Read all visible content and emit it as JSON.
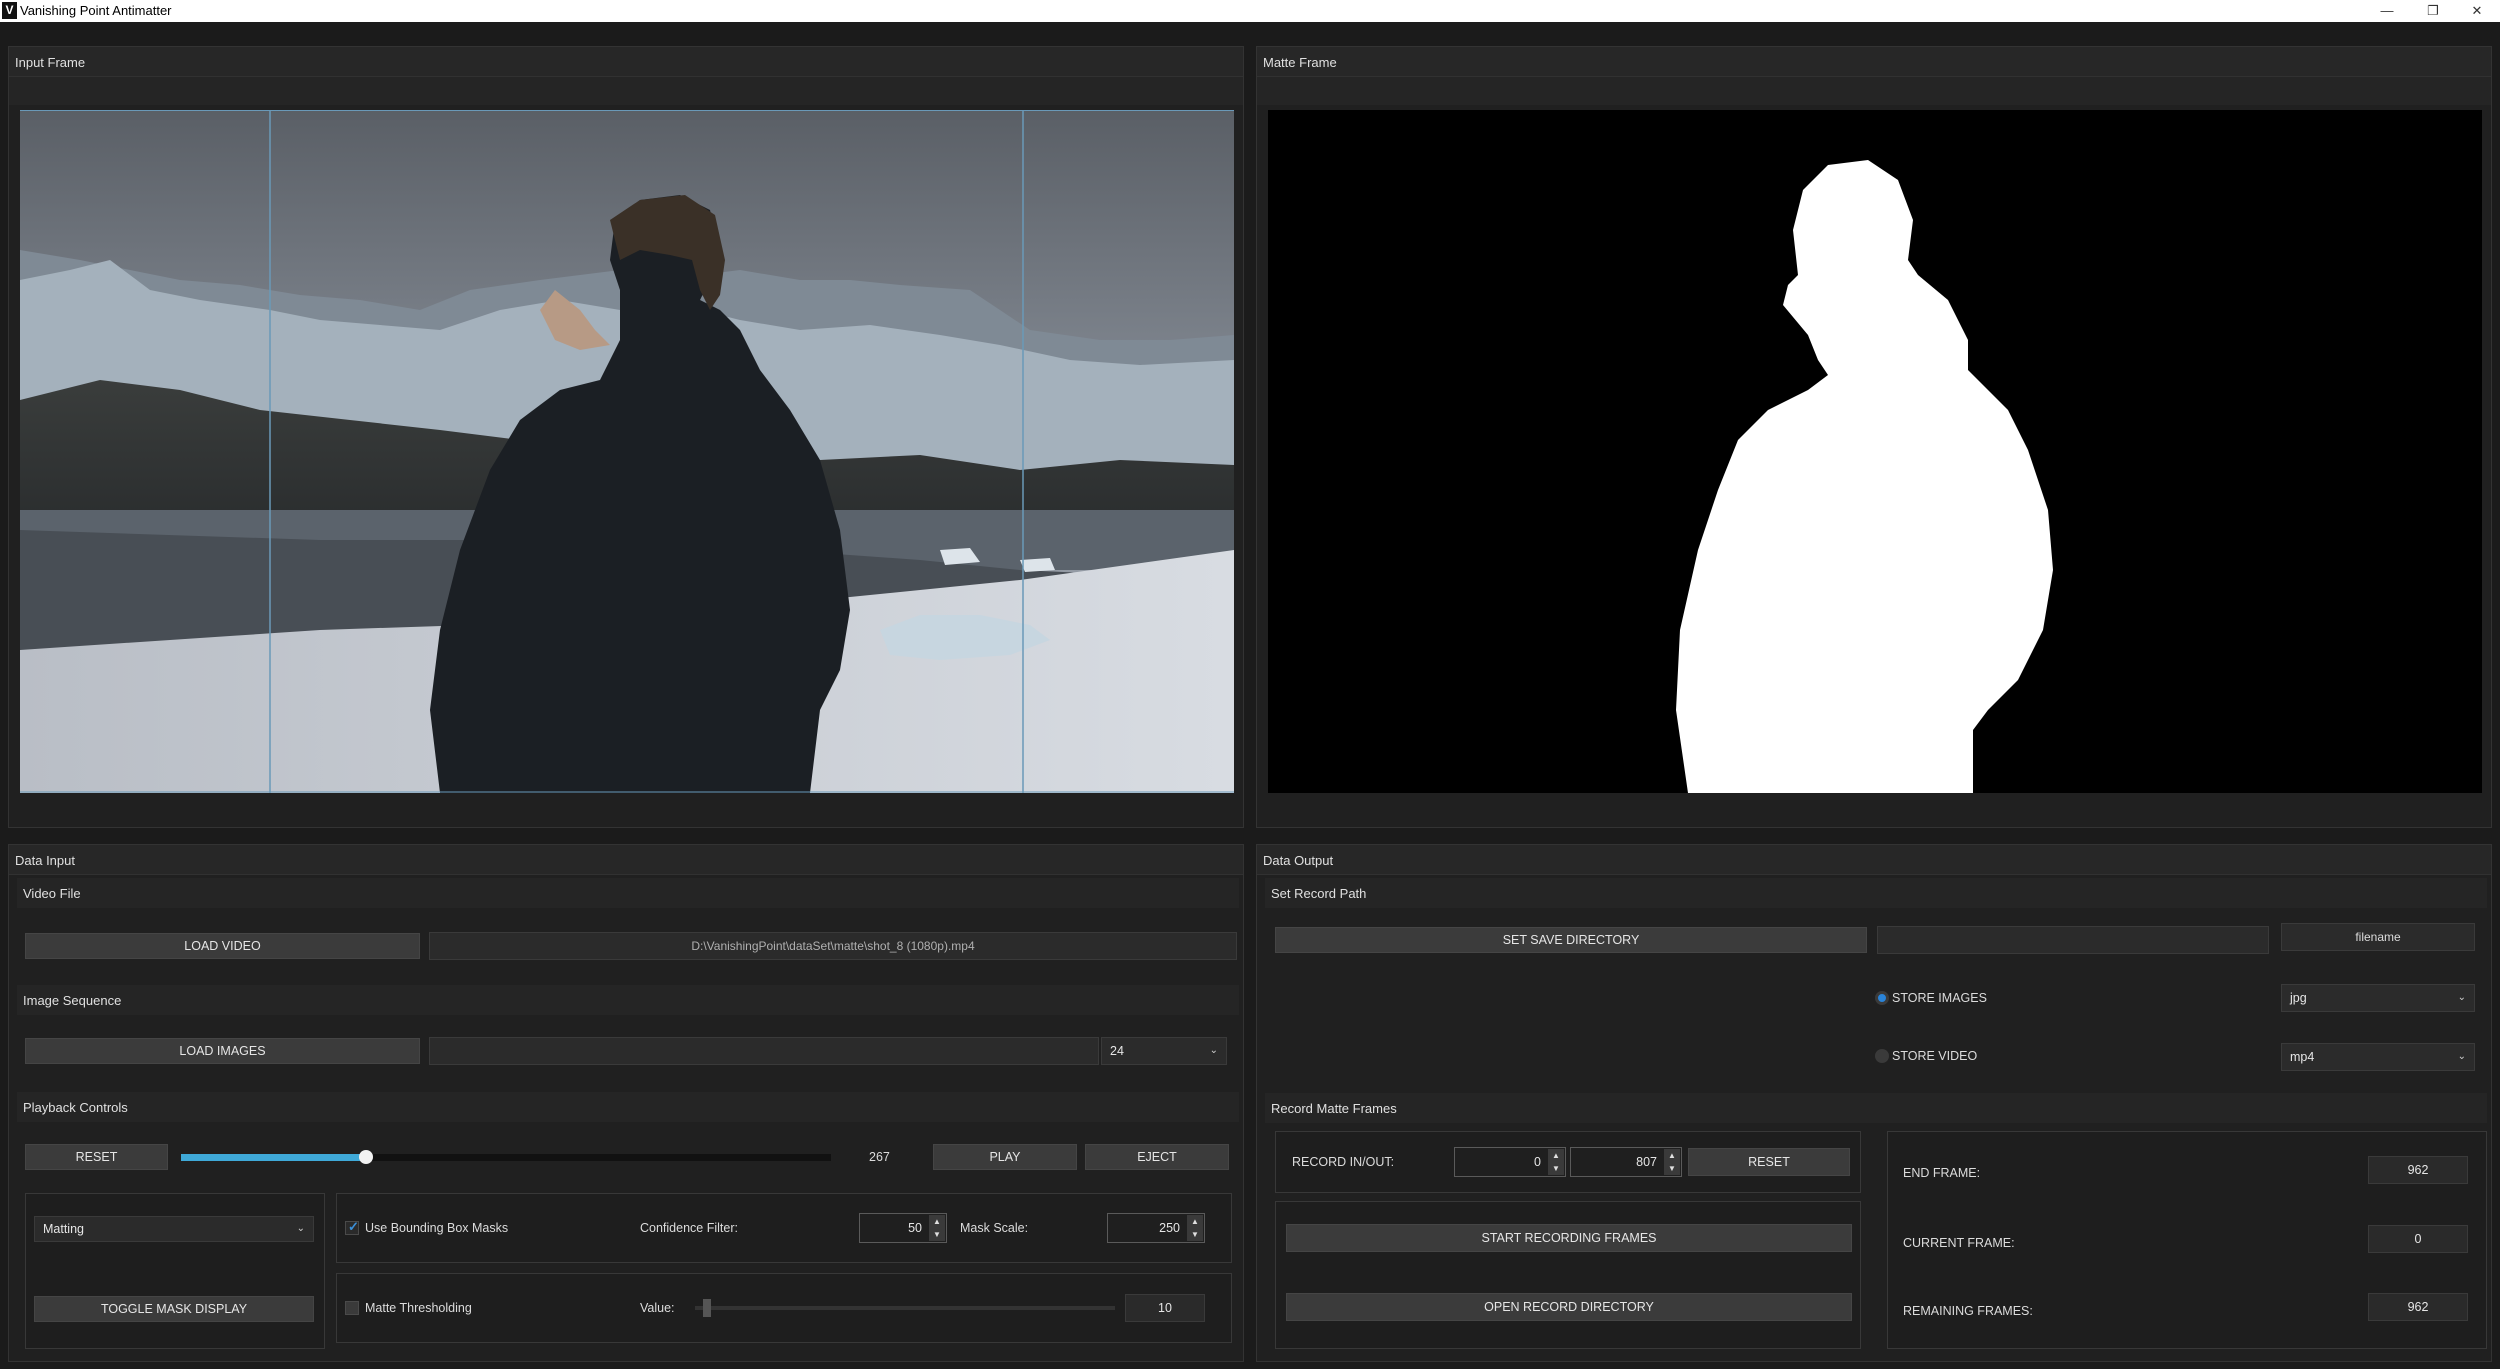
{
  "window": {
    "title": "Vanishing Point Antimatter",
    "logo_letter": "V",
    "minimize": "—",
    "restore": "❐",
    "close": "✕"
  },
  "input_frame": {
    "title": "Input Frame"
  },
  "matte_frame": {
    "title": "Matte Frame"
  },
  "data_input": {
    "title": "Data Input",
    "video_file": {
      "title": "Video File",
      "load_label": "LOAD VIDEO",
      "path": "D:\\VanishingPoint\\dataSet\\matte\\shot_8 (1080p).mp4"
    },
    "image_sequence": {
      "title": "Image Sequence",
      "load_label": "LOAD IMAGES",
      "path": "",
      "fps": "24"
    },
    "playback": {
      "title": "Playback Controls",
      "reset_label": "RESET",
      "frame": "267",
      "progress": 0.285,
      "play_label": "PLAY",
      "eject_label": "EJECT"
    },
    "mode": {
      "selected": "Matting",
      "toggle_label": "TOGGLE MASK DISPLAY"
    },
    "bbox": {
      "checkbox_label": "Use Bounding Box Masks",
      "checked": true,
      "confidence_label": "Confidence Filter:",
      "confidence_value": "50",
      "mask_scale_label": "Mask Scale:",
      "mask_scale_value": "250"
    },
    "threshold": {
      "checkbox_label": "Matte Thresholding",
      "checked": false,
      "value_label": "Value:",
      "value": "10",
      "slider_level": 0.02
    }
  },
  "data_output": {
    "title": "Data Output",
    "record_path": {
      "title": "Set Record Path",
      "save_dir_label": "SET SAVE DIRECTORY",
      "path": "",
      "filename": "filename",
      "store_images_label": "STORE IMAGES",
      "store_images_selected": true,
      "image_format": "jpg",
      "store_video_label": "STORE VIDEO",
      "store_video_selected": false,
      "video_format": "mp4"
    },
    "record_matte": {
      "title": "Record Matte Frames",
      "inout_label": "RECORD IN/OUT:",
      "in_value": "0",
      "out_value": "807",
      "reset_label": "RESET",
      "start_label": "START RECORDING FRAMES",
      "open_dir_label": "OPEN RECORD DIRECTORY",
      "end_frame_label": "END FRAME:",
      "end_frame": "962",
      "current_frame_label": "CURRENT FRAME:",
      "current_frame": "0",
      "remaining_label": "REMAINING FRAMES:",
      "remaining": "962"
    }
  },
  "colors": {
    "accent": "#3fa9d8",
    "radio_on": "#2a84d9"
  }
}
